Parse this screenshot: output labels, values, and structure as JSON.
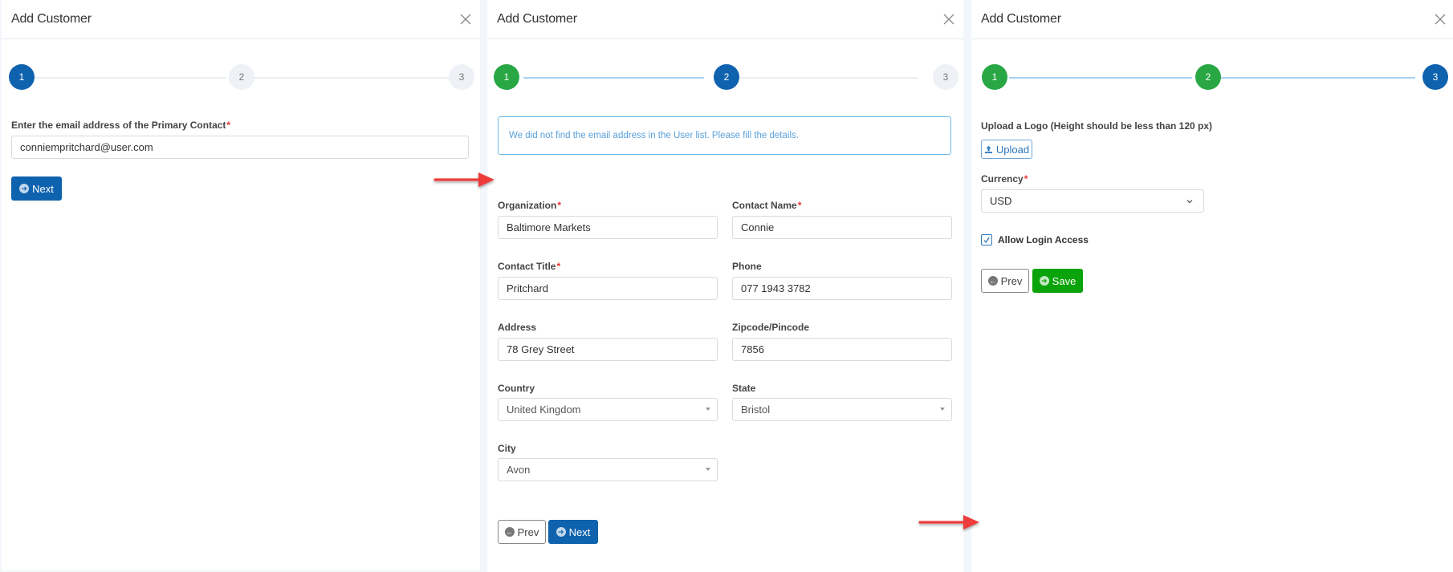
{
  "colors": {
    "primary": "#0f62ae",
    "success": "#0aa30a",
    "step_done": "#29a745",
    "required": "#e33333",
    "alert_text": "#5aa0da",
    "annotation_arrow": "#ee3b3b"
  },
  "panels": [
    {
      "title": "Add Customer",
      "close_icon": "close-icon",
      "steps": [
        {
          "label": "1",
          "state": "active"
        },
        {
          "label": "2",
          "state": "pending"
        },
        {
          "label": "3",
          "state": "pending"
        }
      ],
      "email_label": "Enter the email address of the Primary Contact",
      "required_mark": "*",
      "email_value": "conniempritchard@user.com",
      "next_label": "Next"
    },
    {
      "title": "Add Customer",
      "close_icon": "close-icon",
      "steps": [
        {
          "label": "1",
          "state": "done"
        },
        {
          "label": "2",
          "state": "active"
        },
        {
          "label": "3",
          "state": "pending"
        }
      ],
      "alert": "We did not find the email address in the User list. Please fill the details.",
      "required_mark": "*",
      "fields": {
        "organization": {
          "label": "Organization",
          "required": true,
          "value": "Baltimore Markets"
        },
        "contact_name": {
          "label": "Contact Name",
          "required": true,
          "value": "Connie"
        },
        "contact_title": {
          "label": "Contact Title",
          "required": true,
          "value": "Pritchard"
        },
        "phone": {
          "label": "Phone",
          "required": false,
          "value": "077 1943 3782"
        },
        "address": {
          "label": "Address",
          "required": false,
          "value": "78 Grey Street"
        },
        "zipcode": {
          "label": "Zipcode/Pincode",
          "required": false,
          "value": "7856"
        },
        "country": {
          "label": "Country",
          "required": false,
          "value": "United Kingdom"
        },
        "state": {
          "label": "State",
          "required": false,
          "value": "Bristol"
        },
        "city": {
          "label": "City",
          "required": false,
          "value": "Avon"
        }
      },
      "prev_label": "Prev",
      "next_label": "Next"
    },
    {
      "title": "Add Customer",
      "close_icon": "close-icon",
      "steps": [
        {
          "label": "1",
          "state": "done"
        },
        {
          "label": "2",
          "state": "done"
        },
        {
          "label": "3",
          "state": "active"
        }
      ],
      "logo_label": "Upload a Logo (Height should be less than 120 px)",
      "upload_label": "Upload",
      "currency_label": "Currency",
      "required_mark": "*",
      "currency_value": "USD",
      "allow_login_label": "Allow Login Access",
      "allow_login_checked": true,
      "prev_label": "Prev",
      "save_label": "Save"
    }
  ]
}
